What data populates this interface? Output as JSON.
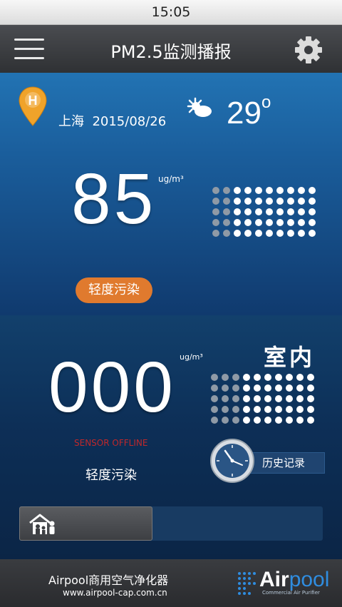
{
  "status_bar": {
    "time": "15:05"
  },
  "app_bar": {
    "title": "PM2.5监测播报",
    "menu_icon": "hamburger-menu-icon",
    "settings_icon": "gear-icon"
  },
  "outdoor": {
    "pin_letter": "H",
    "city": "上海",
    "date": "2015/08/26",
    "weather_icon": "sun-partly-cloudy-icon",
    "temperature": "29",
    "temperature_degree": "o",
    "pm25_value": "85",
    "unit": "ug/m³",
    "level": "轻度污染",
    "level_color": "#e07a2e",
    "dots_filled": 40,
    "dots_total": 50
  },
  "indoor": {
    "label": "室内",
    "pm25_value": "000",
    "unit": "ug/m³",
    "sensor_status": "SENSOR OFFLINE",
    "sensor_status_color": "#c0282b",
    "level": "轻度污染",
    "history_label": "历史记录",
    "history_icon": "clock-icon",
    "home_icon": "home-family-icon",
    "progress_fraction": 0.44,
    "dots_filled": 36,
    "dots_total": 50
  },
  "footer": {
    "company": "Airpool商用空气净化器",
    "website": "www.airpool-cap.com.cn",
    "logo_text_1": "Air",
    "logo_text_2": "pool",
    "logo_tagline": "Commercial  Air Purifier"
  }
}
